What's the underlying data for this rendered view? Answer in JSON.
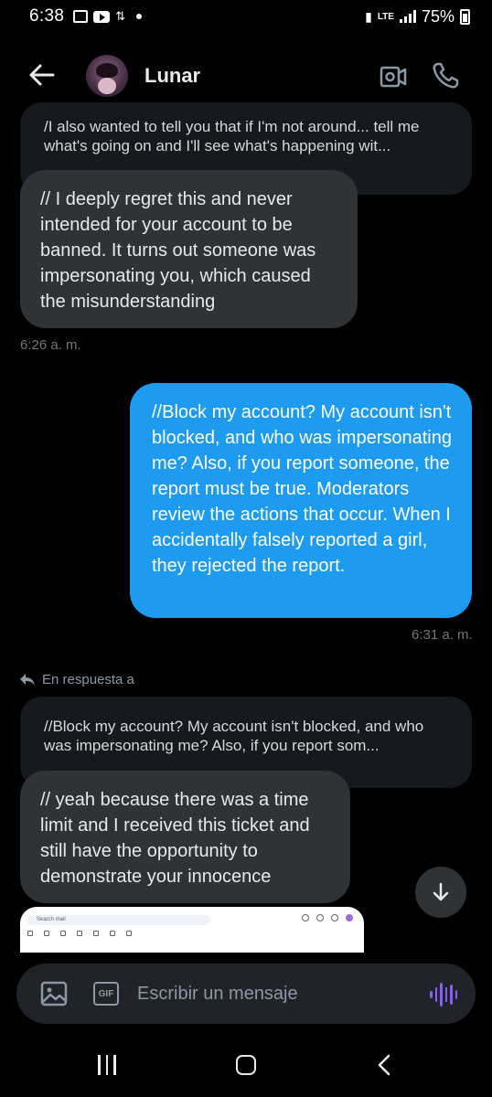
{
  "status_bar": {
    "time": "6:38",
    "network": "LTE",
    "battery": "75%"
  },
  "header": {
    "contact_name": "Lunar",
    "icons": [
      "back-arrow-icon",
      "avatar",
      "video-icon",
      "phone-icon"
    ]
  },
  "messages": {
    "quote1": "/I also wanted to tell you that if I'm not around... tell me what's going on and I'll see what's happening wit...",
    "bubble1": "// I deeply regret this and never intended for your account to be banned. It turns out someone was impersonating you, which caused the misunderstanding",
    "ts1": "6:26 a. m.",
    "bubble2": "//Block my account? My account isn't blocked, and who was impersonating me? Also, if you report someone, the report must be true. Moderators review the actions that occur. When I accidentally falsely reported a girl, they rejected the report.",
    "ts2": "6:31 a. m.",
    "reply_label": "En respuesta a",
    "quote2": "//Block my account? My account isn't blocked, and who was impersonating me? Also, if you report som...",
    "bubble3": "// yeah because there was a time limit and I received this ticket and still have the opportunity to demonstrate your innocence"
  },
  "image_preview": {
    "search_text": "Search mail"
  },
  "composer": {
    "placeholder": "Escribir un mensaje",
    "gif_label": "GIF"
  },
  "colors": {
    "outgoing": "#1d9bf0",
    "incoming": "#2f3336",
    "accent_voice": "#8b5cf6"
  }
}
